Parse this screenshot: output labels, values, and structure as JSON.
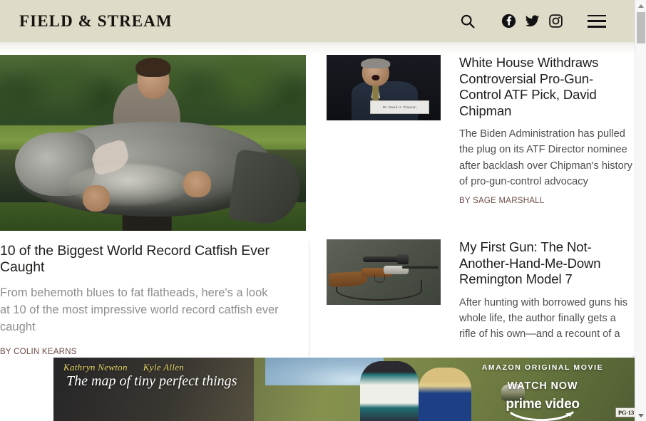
{
  "header": {
    "brand": "FIELD & STREAM",
    "bg_color": "#dedbc8",
    "icons": {
      "search": "search-icon",
      "facebook": "facebook-icon",
      "twitter": "twitter-icon",
      "instagram": "instagram-icon",
      "menu": "hamburger-menu-icon"
    }
  },
  "hero": {
    "title": "10 of the Biggest World Record Catfish Ever Caught",
    "dek": "From behemoth blues to fat flatheads, here's a look at 10 of the most impressive world record catfish ever caught",
    "byline": "BY COLIN KEARNS",
    "image_alt": "Young angler holding an enormous blue catfish beside a pond"
  },
  "cards": [
    {
      "title": "White House Withdraws Controversial Pro-Gun-Control ATF Pick, David Chipman",
      "dek": "The Biden Administration has pulled the plug on its ATF Director nominee after backlash over Chipman's history of pro-gun-control advocacy",
      "byline": "BY SAGE MARSHALL",
      "image_alt": "David Chipman speaking at a Senate hearing",
      "nameplate": "Mr. David H. Chipman"
    },
    {
      "title": "My First Gun: The Not-Another-Hand-Me-Down Remington Model 7",
      "dek": "After hunting with borrowed guns his whole life, the author finally gets a rifle of his own—and a recount of a",
      "byline": "",
      "image_alt": "Scoped bolt-action rifle with leather sling on a gray background"
    }
  ],
  "ad": {
    "cast": [
      "Kathryn Newton",
      "Kyle Allen"
    ],
    "title": "The map of tiny perfect things",
    "kicker": "AMAZON ORIGINAL MOVIE",
    "cta": "WATCH NOW",
    "brand": "prime video",
    "rating": "PG-13",
    "close_label": "×"
  },
  "colors": {
    "byline": "#6d4a46",
    "header_bg": "#dedbc8",
    "dek_muted": "#8e8e8e"
  }
}
